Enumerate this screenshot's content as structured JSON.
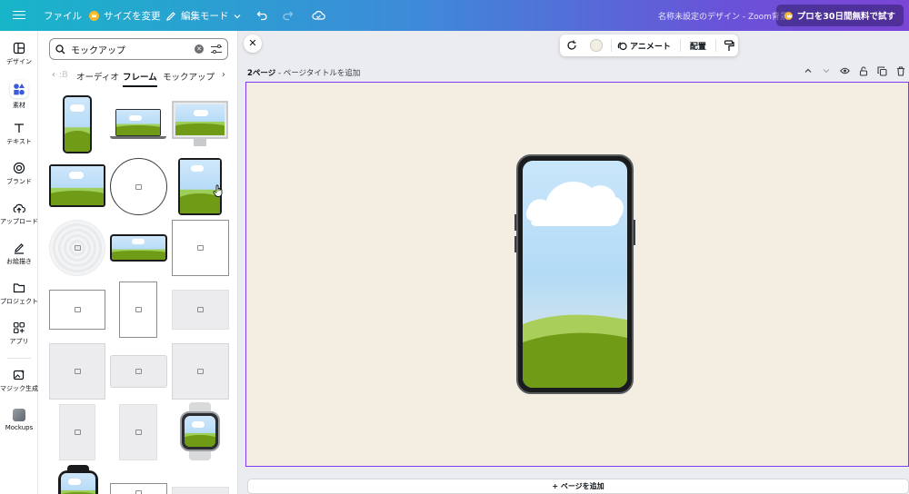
{
  "topbar": {
    "file": "ファイル",
    "resize": "サイズを変更",
    "edit_mode": "編集モード",
    "title": "名称未設定のデザイン - Zoom背景",
    "pro": "プロを30日間無料で試す"
  },
  "rail": {
    "items": [
      "デザイン",
      "素材",
      "テキスト",
      "ブランド",
      "アップロード",
      "お絵描き",
      "プロジェクト",
      "アプリ",
      "マジック生成",
      "Mockups"
    ]
  },
  "panel": {
    "search_value": "モックアップ",
    "tabs": [
      "オーディオ",
      "フレーム",
      "モックアップ"
    ],
    "active_tab": "フレーム"
  },
  "canvas": {
    "context_bar": {
      "animate": "アニメート",
      "arrange": "配置"
    },
    "page_label": "2ページ",
    "page_title_placeholder": "ページタイトルを追加",
    "add_page": "+ ページを追加"
  },
  "colors": {
    "page_bg": "#f3ede2",
    "selection": "#7d3cf0",
    "sky": "#c9e6fb",
    "grass": "#6f9b16"
  }
}
